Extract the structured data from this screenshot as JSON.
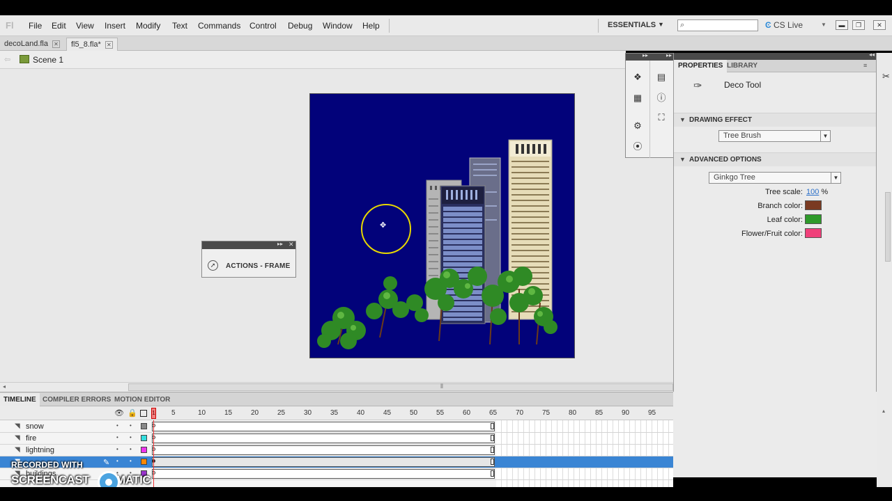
{
  "app": {
    "logo": "Fl",
    "workspace": "ESSENTIALS",
    "cs_live": "CS Live",
    "search": {
      "value": ""
    }
  },
  "menu": [
    "File",
    "Edit",
    "View",
    "Insert",
    "Modify",
    "Text",
    "Commands",
    "Control",
    "Debug",
    "Window",
    "Help"
  ],
  "tabs": [
    {
      "label": "decoLand.fla",
      "active": false
    },
    {
      "label": "fl5_8.fla*",
      "active": true
    }
  ],
  "editbar": {
    "scene": "Scene 1"
  },
  "actions_panel": {
    "label": "ACTIONS - FRAME"
  },
  "properties": {
    "tabs": [
      "PROPERTIES",
      "LIBRARY"
    ],
    "tool_name": "Deco Tool",
    "drawing_effect": {
      "title": "DRAWING EFFECT",
      "value": "Tree Brush"
    },
    "advanced_options": {
      "title": "ADVANCED OPTIONS",
      "value": "Ginkgo Tree",
      "tree_scale_label": "Tree scale:",
      "tree_scale_value": "100",
      "tree_scale_unit": "%",
      "branch_color_label": "Branch color:",
      "leaf_color_label": "Leaf color:",
      "flower_color_label": "Flower/Fruit color:"
    },
    "colors": {
      "branch": "#7a3a22",
      "leaf": "#2e9a2a",
      "flower": "#f0407a"
    }
  },
  "timeline": {
    "tabs": [
      "TIMELINE",
      "COMPILER ERRORS",
      "MOTION EDITOR"
    ],
    "frame_numbers": [
      "1",
      "5",
      "10",
      "15",
      "20",
      "25",
      "30",
      "35",
      "40",
      "45",
      "50",
      "55",
      "60",
      "65",
      "70",
      "75",
      "80",
      "85",
      "90",
      "95"
    ],
    "current_frame": "1",
    "layers": [
      {
        "name": "snow",
        "color": "#888888",
        "selected": false
      },
      {
        "name": "fire",
        "color": "#33dddd",
        "selected": false
      },
      {
        "name": "lightning",
        "color": "#ee33ee",
        "selected": false
      },
      {
        "name": "",
        "color": "#ff8800",
        "selected": true
      },
      {
        "name": "buildings",
        "color": "#9933cc",
        "selected": false
      }
    ]
  },
  "watermark": {
    "line1": "RECORDED WITH",
    "line2": "SCREENCAST",
    "line3": "MATIC"
  },
  "accent": {
    "stage": "#02027a",
    "cursor_ring": "#e8d800",
    "selection": "#3a85d4"
  }
}
